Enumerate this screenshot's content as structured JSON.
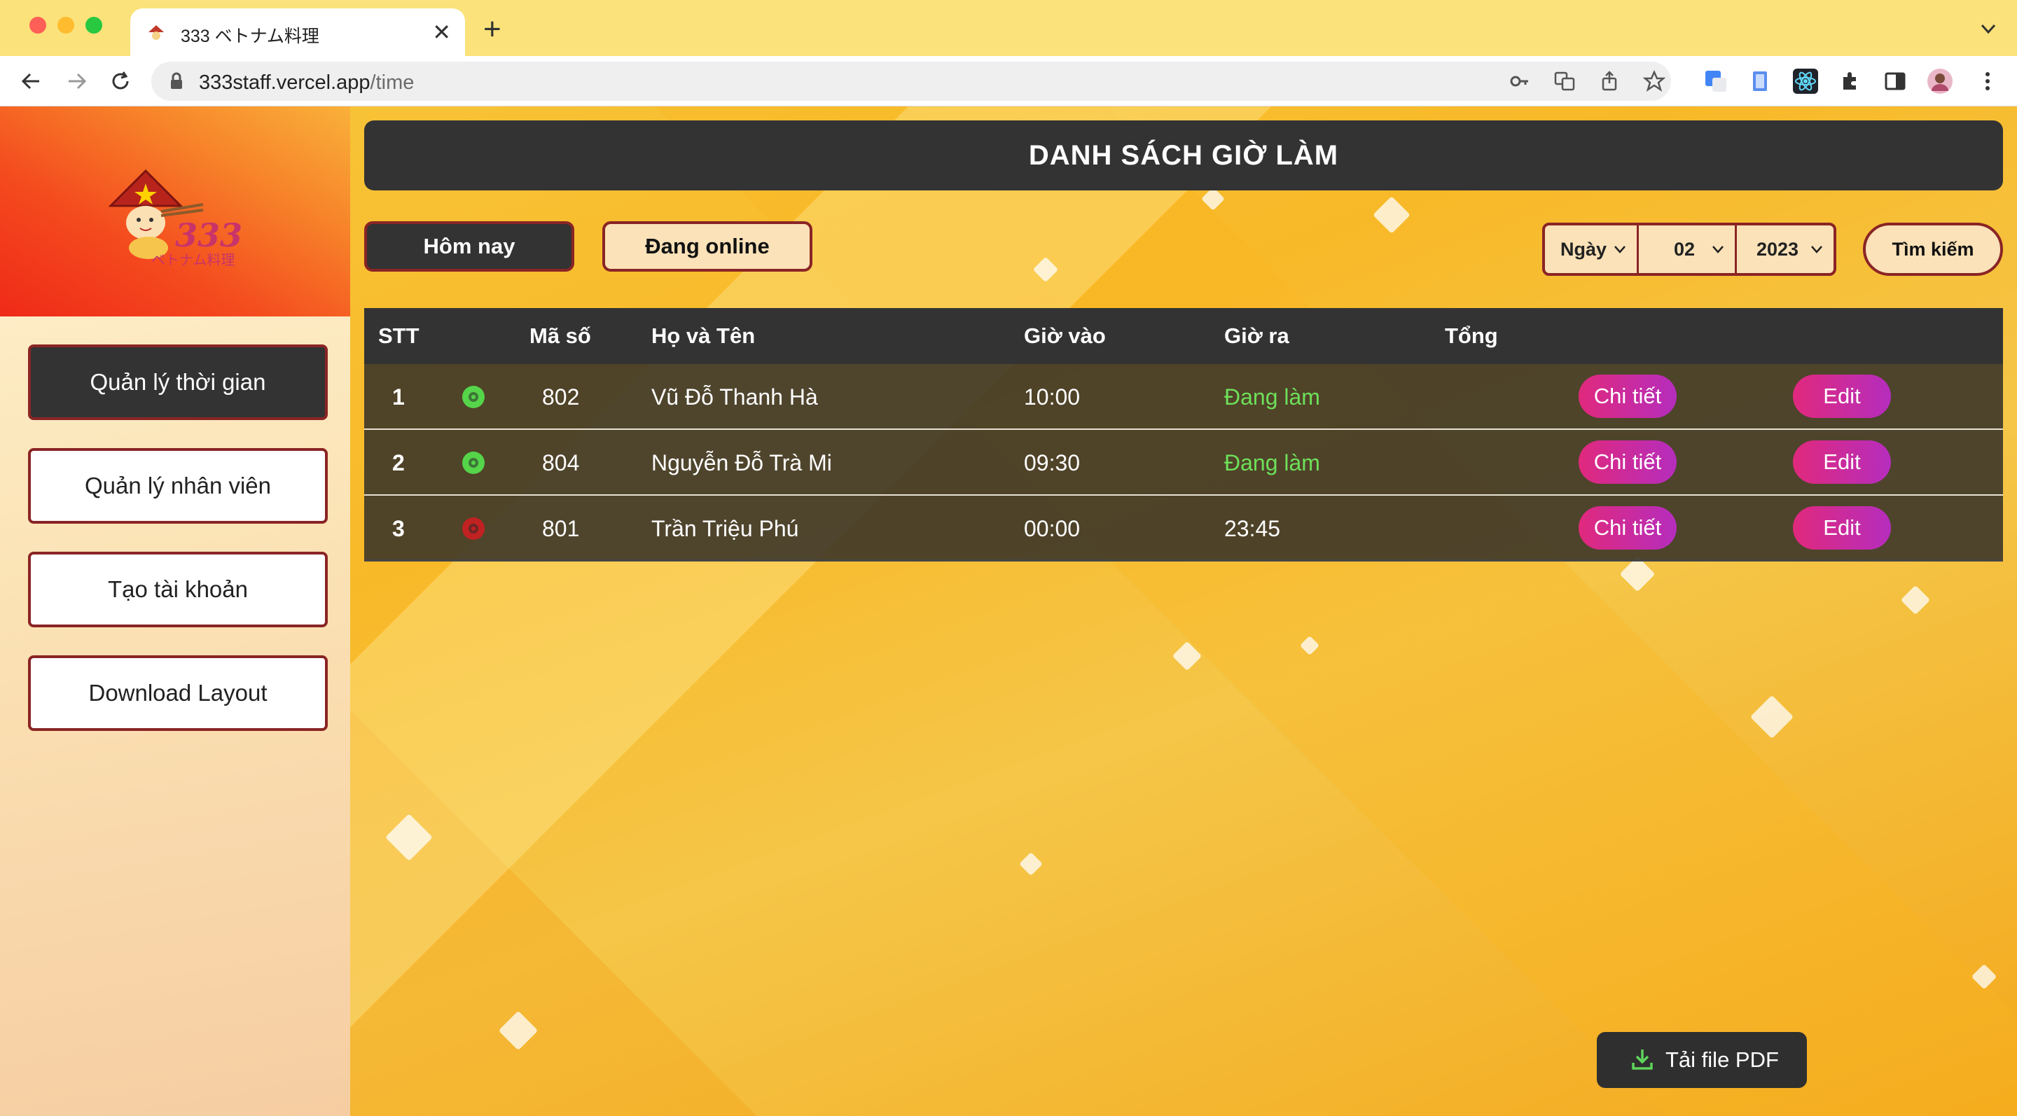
{
  "browser": {
    "tab_title": "333 ベトナム料理",
    "new_tab": "+",
    "tab_close": "✕",
    "url_host": "333staff.vercel.app",
    "url_path": "/time"
  },
  "sidebar": {
    "logo_text_main": "333",
    "logo_text_sub": "ベトナム料理",
    "items": [
      {
        "label": "Quản lý thời gian",
        "active": true
      },
      {
        "label": "Quản lý nhân viên",
        "active": false
      },
      {
        "label": "Tạo tài khoản",
        "active": false
      },
      {
        "label": "Download Layout",
        "active": false
      }
    ]
  },
  "main": {
    "title": "DANH SÁCH GIỜ LÀM",
    "filters": {
      "today_label": "Hôm nay",
      "online_label": "Đang online",
      "day_value": "Ngày",
      "month_value": "02",
      "year_value": "2023",
      "search_label": "Tìm kiếm"
    },
    "table": {
      "headers": [
        "STT",
        "Mã số",
        "Họ và Tên",
        "Giờ vào",
        "Giờ ra",
        "Tổng"
      ],
      "rows": [
        {
          "stt": "1",
          "status": "online",
          "id": "802",
          "name": "Vũ Đỗ Thanh Hà",
          "time_in": "10:00",
          "time_out": "Đang làm",
          "total": "",
          "detail_label": "Chi tiết",
          "edit_label": "Edit"
        },
        {
          "stt": "2",
          "status": "online",
          "id": "804",
          "name": "Nguyễn Đỗ Trà Mi",
          "time_in": "09:30",
          "time_out": "Đang làm",
          "total": "",
          "detail_label": "Chi tiết",
          "edit_label": "Edit"
        },
        {
          "stt": "3",
          "status": "offline",
          "id": "801",
          "name": "Trần Triệu Phú",
          "time_in": "00:00",
          "time_out": "23:45",
          "total": "",
          "detail_label": "Chi tiết",
          "edit_label": "Edit"
        }
      ]
    },
    "pdf_label": "Tải file PDF"
  },
  "colors": {
    "online": "#56d44a",
    "offline": "#c02222",
    "working_text": "#6ee05a",
    "accent_border": "#8a2525",
    "dark_panel": "#333333"
  }
}
